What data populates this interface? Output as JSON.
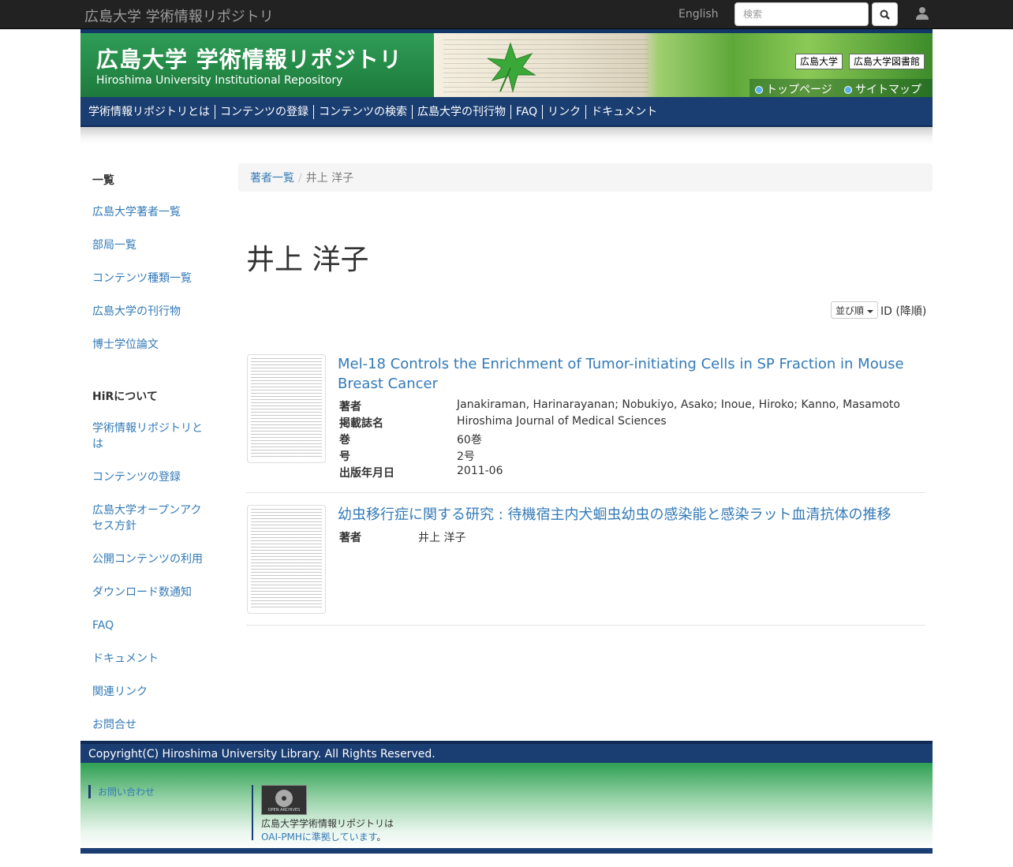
{
  "topbar": {
    "brand": "広島大学 学術情報リポジトリ",
    "language": "English",
    "search_placeholder": "検索"
  },
  "banner": {
    "title_jp": "広島大学 学術情報リポジトリ",
    "title_en": "Hiroshima University Institutional Repository",
    "ext_links": [
      "広島大学",
      "広島大学図書館"
    ],
    "top_links": [
      "トップページ",
      "サイトマップ"
    ]
  },
  "main_nav": [
    "学術情報リポジトリとは",
    "コンテンツの登録",
    "コンテンツの検索",
    "広島大学の刊行物",
    "FAQ",
    "リンク",
    "ドキュメント"
  ],
  "sidebar": {
    "list_heading": "一覧",
    "list_items": [
      "広島大学著者一覧",
      "部局一覧",
      "コンテンツ種類一覧",
      "広島大学の刊行物",
      "博士学位論文"
    ],
    "about_heading": "HiRについて",
    "about_items": [
      "学術情報リポジトリとは",
      "コンテンツの登録",
      "広島大学オープンアクセス方針",
      "公開コンテンツの利用",
      "ダウンロード数通知",
      "FAQ",
      "ドキュメント",
      "関連リンク",
      "お問合せ"
    ]
  },
  "breadcrumb": {
    "parent": "著者一覧",
    "separator": "/",
    "current": "井上 洋子"
  },
  "page_title": "井上 洋子",
  "sort": {
    "button": "並び順",
    "label": "ID (降順)"
  },
  "items": [
    {
      "title": "Mel-18 Controls the Enrichment of Tumor-initiating Cells in SP Fraction in Mouse Breast Cancer",
      "meta": [
        {
          "k": "著者",
          "v": "Janakiraman, Harinarayanan; Nobukiyo, Asako; Inoue, Hiroko; Kanno, Masamoto"
        },
        {
          "k": "掲載誌名",
          "v": "Hiroshima Journal of Medical Sciences"
        },
        {
          "k": "巻",
          "v": "60巻"
        },
        {
          "k": "号",
          "v": "2号"
        },
        {
          "k": "出版年月日",
          "v": "2011-06"
        }
      ]
    },
    {
      "title": "幼虫移行症に関する研究 : 待機宿主内犬蛔虫幼虫の感染能と感染ラット血清抗体の推移",
      "meta": [
        {
          "k": "著者",
          "v": "井上 洋子"
        }
      ]
    }
  ],
  "footer": {
    "copyright": "Copyright(C) Hiroshima University Library. All Rights Reserved.",
    "contact": "お問い合わせ",
    "oai_text": "広島大学学術情報リポジトリは",
    "oai_link": "OAI-PMHに準拠しています",
    "oai_suffix": "。",
    "oai_logo_text": "OPEN ARCHIVES"
  }
}
